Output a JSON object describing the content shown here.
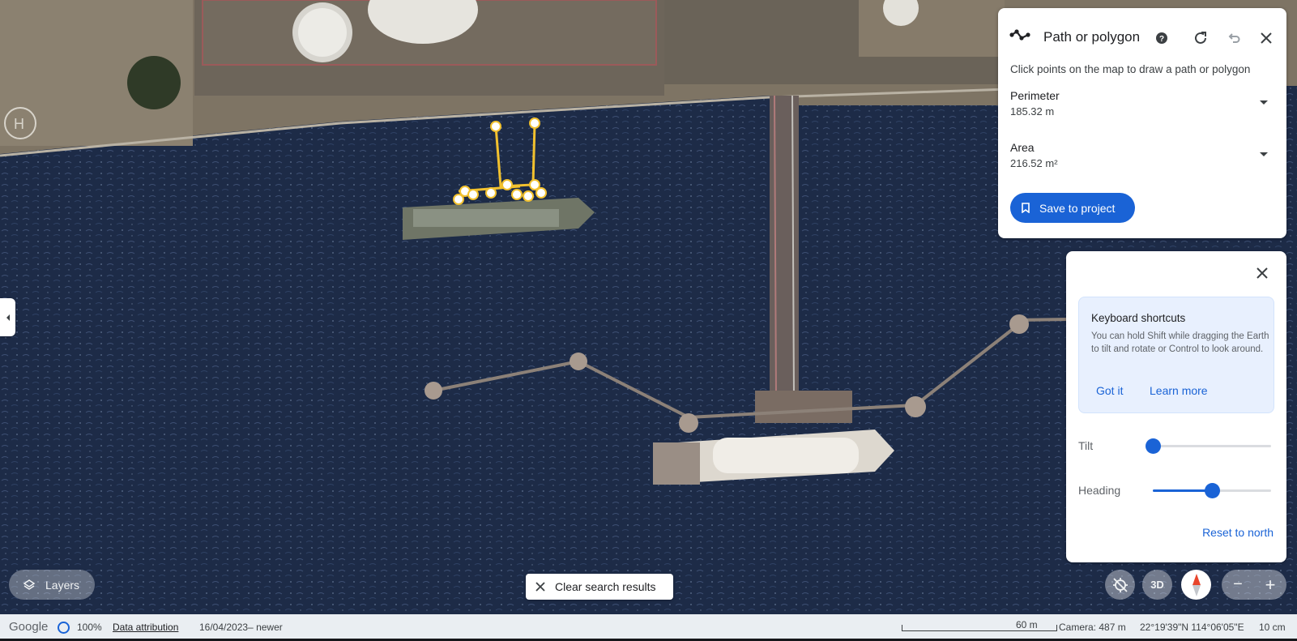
{
  "measure_panel": {
    "title": "Path or polygon",
    "hint": "Click points on the map to draw a path or polygon",
    "perimeter_label": "Perimeter",
    "perimeter_value": "185.32 m",
    "area_label": "Area",
    "area_value": "216.52 m²",
    "save_label": "Save to project",
    "icons": [
      "path-icon",
      "help-icon",
      "refresh-icon",
      "undo-icon",
      "close-icon"
    ]
  },
  "view_panel": {
    "shortcuts_title": "Keyboard shortcuts",
    "shortcuts_desc": "You can hold Shift while dragging the Earth to tilt and rotate or Control to look around.",
    "got_it": "Got it",
    "learn_more": "Learn more",
    "tilt_label": "Tilt",
    "tilt_fraction": 0.0,
    "heading_label": "Heading",
    "heading_fraction": 0.5,
    "reset_label": "Reset to north"
  },
  "map_controls": {
    "layers_label": "Layers",
    "clear_search_label": "Clear search results",
    "mode_3d_label": "3D",
    "zoom_out": "−",
    "zoom_in": "+"
  },
  "status_bar": {
    "brand": "Google",
    "load_percent": "100%",
    "attribution": "Data attribution",
    "imagery_date": "16/04/2023– newer",
    "scale_label": "60 m",
    "camera": "Camera: 487 m",
    "coordinates": "22°19'39\"N 114°06'05\"E",
    "resolution": "10 cm"
  },
  "colors": {
    "accent": "#1a63d6",
    "measure_line": "#f2c12e",
    "water": "#1e2c48"
  }
}
